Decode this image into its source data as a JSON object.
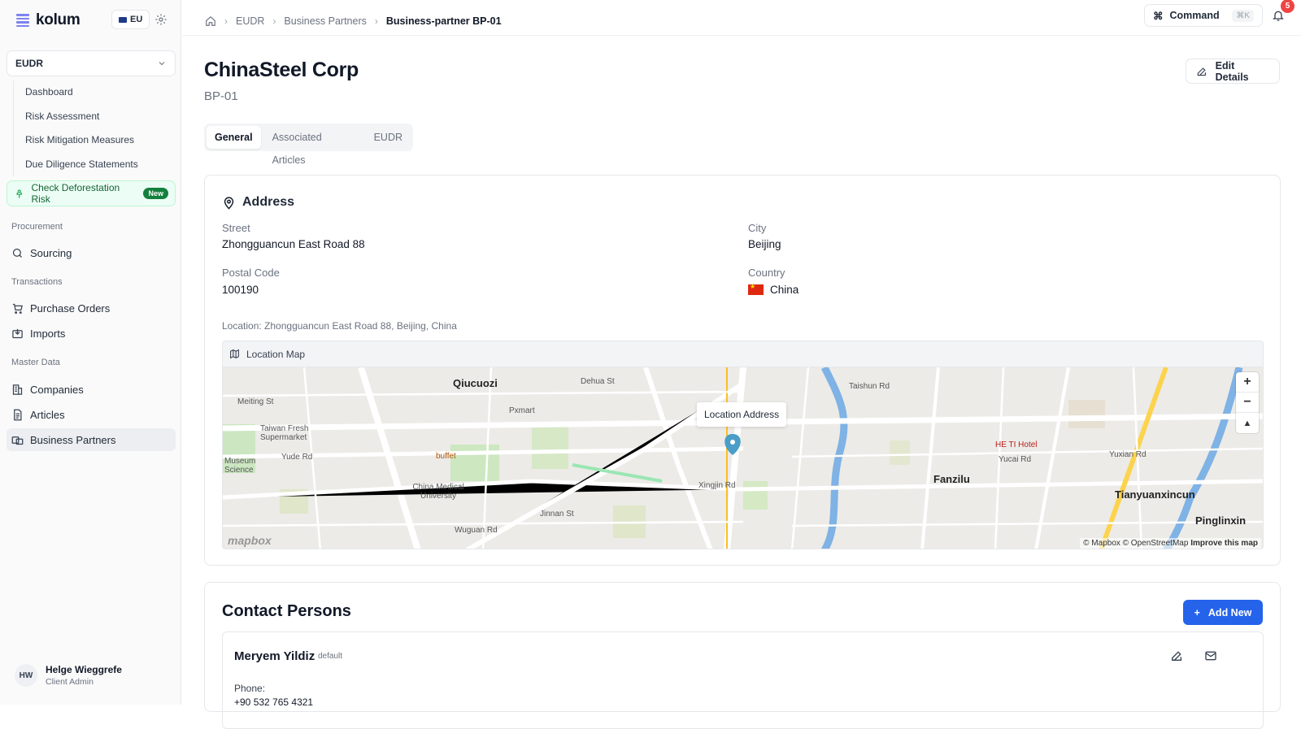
{
  "app": {
    "name": "kolum",
    "region": "EU"
  },
  "sidebar": {
    "module": "EUDR",
    "subnav": [
      "Dashboard",
      "Risk Assessment",
      "Risk Mitigation Measures",
      "Due Diligence Statements"
    ],
    "cta": {
      "label": "Check Deforestation Risk",
      "badge": "New"
    },
    "sections": [
      {
        "label": "Procurement",
        "items": [
          "Sourcing"
        ]
      },
      {
        "label": "Transactions",
        "items": [
          "Purchase Orders",
          "Imports"
        ]
      },
      {
        "label": "Master Data",
        "items": [
          "Companies",
          "Articles",
          "Business Partners"
        ]
      }
    ],
    "user": {
      "initials": "HW",
      "name": "Helge Wieggrefe",
      "role": "Client Admin"
    }
  },
  "header": {
    "breadcrumb": [
      "EUDR",
      "Business Partners",
      "Business-partner BP-01"
    ],
    "command": {
      "label": "Command",
      "shortcut": "⌘K"
    },
    "notifications": "5"
  },
  "page": {
    "title": "ChinaSteel Corp",
    "id": "BP-01",
    "edit_label": "Edit Details",
    "tabs": [
      "General",
      "Associated Articles",
      "EUDR"
    ],
    "active_tab": "General"
  },
  "address": {
    "heading": "Address",
    "street_label": "Street",
    "street": "Zhongguancun East Road 88",
    "city_label": "City",
    "city": "Beijing",
    "postal_label": "Postal Code",
    "postal": "100190",
    "country_label": "Country",
    "country": "China",
    "location_note": "Location: Zhongguancun East Road 88, Beijing, China"
  },
  "map": {
    "title": "Location Map",
    "popup": "Location Address",
    "logo": "mapbox",
    "attribution_plain": "© Mapbox © OpenStreetMap",
    "attribution_bold": "Improve this map",
    "labels": [
      "Qiucuozi",
      "Fanzilu",
      "Tianyuanxincun",
      "Pinglinxin",
      "Meiting St",
      "Dehua St",
      "Taishun Rd",
      "Yude Rd",
      "Xingjin Rd",
      "Jinnan St",
      "Wuguan Rd",
      "Yucai Rd",
      "Yuxian Rd",
      "Taiwan Fresh Supermarket",
      "China Medical University",
      "Museum Science",
      "Pxmart",
      "buffet",
      "HE TI Hotel"
    ]
  },
  "contacts": {
    "heading": "Contact Persons",
    "add_label": "Add New",
    "items": [
      {
        "name": "Meryem Yildiz",
        "tag": "default",
        "phone_label": "Phone:",
        "phone": "+90 532 765 4321"
      }
    ]
  },
  "colors": {
    "accent": "#2563eb",
    "cta_bg": "#ecfdf5",
    "cta_text": "#166534",
    "badge": "#ef4444"
  }
}
